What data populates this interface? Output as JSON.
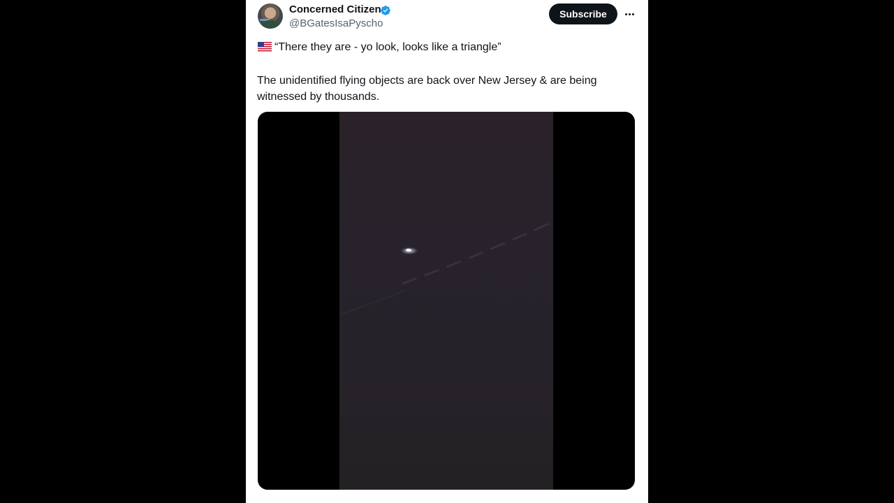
{
  "author": {
    "display_name": "Concerned Citizen",
    "handle": "@BGatesIsaPyscho",
    "verified": true
  },
  "actions": {
    "subscribe_label": "Subscribe",
    "more_icon": "more-horizontal-icon"
  },
  "tweet": {
    "flag_icon": "us-flag-icon",
    "quote": "“There they are - yo look, looks like a triangle”",
    "body": "The unidentified flying objects are back over New Jersey & are being witnessed by thousands."
  },
  "media": {
    "type": "video",
    "description_icon": "video-player"
  },
  "colors": {
    "background": "#000000",
    "card": "#ffffff",
    "text_primary": "#0f1419",
    "text_secondary": "#536471",
    "verified": "#1d9bf0",
    "button_bg": "#0f1419"
  }
}
